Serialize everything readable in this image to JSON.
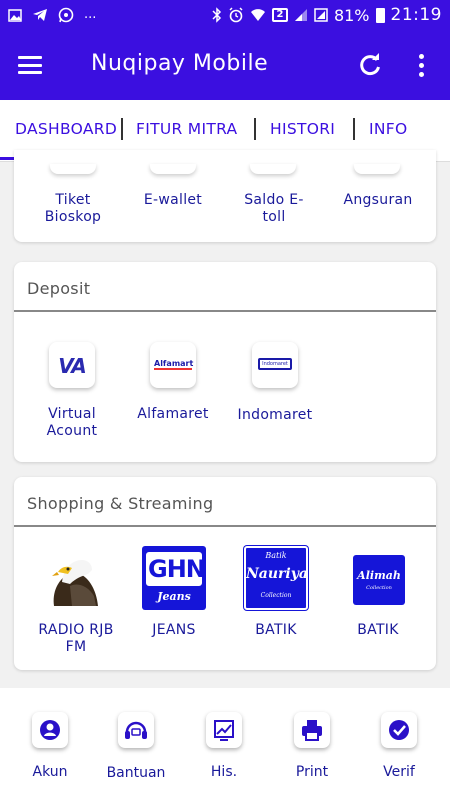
{
  "status_bar": {
    "left_icons": [
      "image-icon",
      "telegram-icon",
      "whatsapp-icon"
    ],
    "more": "...",
    "sim_label": "2",
    "battery_percent": "81%",
    "time": "21:19"
  },
  "app_bar": {
    "title": "Nuqipay Mobile",
    "icons": [
      "menu-icon",
      "refresh-icon",
      "more-vertical-icon"
    ]
  },
  "tabs": [
    {
      "label": "DASHBOARD",
      "active": true
    },
    {
      "label": "FITUR MITRA",
      "active": false
    },
    {
      "label": "HISTORI",
      "active": false
    },
    {
      "label": "INFO",
      "active": false
    }
  ],
  "top_card": {
    "items": [
      {
        "label": "Tiket Bioskop"
      },
      {
        "label": "E-wallet"
      },
      {
        "label": "Saldo E-toll"
      },
      {
        "label": "Angsuran"
      }
    ]
  },
  "deposit": {
    "title": "Deposit",
    "items": [
      {
        "label": "Virtual Acount",
        "icon_text": "VA"
      },
      {
        "label": "Alfamaret",
        "icon_text": "Alfamart"
      },
      {
        "label": "Indomaret",
        "icon_text": "Indomaret"
      }
    ]
  },
  "shopping": {
    "title": "Shopping & Streaming",
    "items": [
      {
        "label": "RADIO RJB FM",
        "icon": "eagle-icon"
      },
      {
        "label": "JEANS",
        "logo_text": "GHN",
        "logo_sub": "Jeans"
      },
      {
        "label": "BATIK",
        "logo_top": "Batik",
        "logo_text": "Nauriya",
        "logo_sub": "Collection"
      },
      {
        "label": "BATIK",
        "logo_text": "Alimah",
        "logo_sub": "Collection"
      }
    ]
  },
  "bottom_nav": {
    "items": [
      {
        "label": "Akun",
        "icon": "account-icon"
      },
      {
        "label": "Bantuan",
        "icon": "headset-icon"
      },
      {
        "label": "His.",
        "icon": "chart-icon"
      },
      {
        "label": "Print",
        "icon": "printer-icon"
      },
      {
        "label": "Verif",
        "icon": "check-circle-icon"
      }
    ]
  },
  "colors": {
    "primary": "#3b0fe0",
    "label": "#1a1a9a",
    "background": "#f1f1f1"
  }
}
